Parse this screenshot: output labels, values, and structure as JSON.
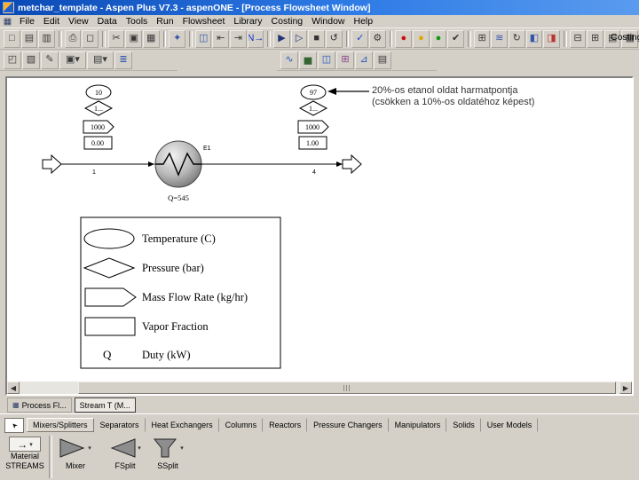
{
  "window": {
    "title": "metchar_template - Aspen Plus V7.3 - aspenONE - [Process Flowsheet Window]"
  },
  "menu": {
    "items": [
      "File",
      "Edit",
      "View",
      "Data",
      "Tools",
      "Run",
      "Flowsheet",
      "Library",
      "Costing",
      "Window",
      "Help"
    ]
  },
  "costing_button": {
    "label": "Costing"
  },
  "toolbar_main": {
    "buttons": [
      {
        "name": "new-icon",
        "glyph": "□"
      },
      {
        "name": "open-icon",
        "glyph": "▤"
      },
      {
        "name": "save-icon",
        "glyph": "▥"
      },
      {
        "sep": true
      },
      {
        "name": "print-icon",
        "glyph": "⎙"
      },
      {
        "name": "print-preview-icon",
        "glyph": "◻"
      },
      {
        "sep": true
      },
      {
        "name": "cut-icon",
        "glyph": "✂"
      },
      {
        "name": "copy-icon",
        "glyph": "▣"
      },
      {
        "name": "paste-icon",
        "glyph": "▦"
      },
      {
        "sep": true
      },
      {
        "name": "analysis-tools-icon",
        "glyph": "✦",
        "color": "#3355aa"
      },
      {
        "sep": true
      },
      {
        "name": "data-browser-icon",
        "glyph": "◫",
        "color": "#3355aa"
      },
      {
        "name": "prev-input-icon",
        "glyph": "⇤"
      },
      {
        "name": "next-input-icon",
        "glyph": "⇥"
      },
      {
        "name": "next-step-icon",
        "glyph": "N→",
        "color": "#1133bb"
      },
      {
        "sep": true
      },
      {
        "name": "run-icon",
        "glyph": "▶",
        "color": "#223377"
      },
      {
        "name": "step-run-icon",
        "glyph": "▷",
        "color": "#223377"
      },
      {
        "name": "stop-icon",
        "glyph": "■",
        "color": "#333333"
      },
      {
        "name": "reinitialize-icon",
        "glyph": "↺",
        "color": "#333333"
      },
      {
        "sep": true
      },
      {
        "name": "control-panel-icon",
        "glyph": "✓",
        "color": "#1144cc"
      },
      {
        "name": "settings-icon",
        "glyph": "⚙"
      },
      {
        "sep": true
      },
      {
        "name": "status-error-icon",
        "glyph": "●",
        "color": "#cc1111"
      },
      {
        "name": "status-warning-icon",
        "glyph": "●",
        "color": "#ddaa00"
      },
      {
        "name": "status-ok-icon",
        "glyph": "●",
        "color": "#119911"
      },
      {
        "name": "check-results-icon",
        "glyph": "✔",
        "color": "#333333"
      },
      {
        "sep": true
      },
      {
        "name": "insert-block-icon",
        "glyph": "⊞"
      },
      {
        "name": "exchanger-curves-icon",
        "glyph": "≋",
        "color": "#3355aa"
      },
      {
        "name": "rotate-icon",
        "glyph": "↻"
      },
      {
        "name": "flip-icon",
        "glyph": "◧",
        "color": "#3355aa"
      },
      {
        "name": "economics-icon",
        "glyph": "◨",
        "color": "#bb3333"
      },
      {
        "sep": true
      },
      {
        "name": "stream-table-icon",
        "glyph": "⊟"
      },
      {
        "name": "property-table-icon",
        "glyph": "⊞"
      },
      {
        "name": "report-icon",
        "glyph": "▤"
      },
      {
        "name": "matrix-icon",
        "glyph": "▦"
      }
    ]
  },
  "toolbar_secondary_left": {
    "buttons": [
      {
        "name": "zoom-full-icon",
        "glyph": "◰"
      },
      {
        "name": "annotation-icon",
        "glyph": "▧"
      },
      {
        "name": "draw-text-icon",
        "glyph": "✎"
      },
      {
        "name": "view-scale-dropdown",
        "glyph": "▣▾",
        "wide": true
      },
      {
        "name": "section-dropdown",
        "glyph": "▤▾",
        "wide": true
      },
      {
        "name": "grid-icon",
        "glyph": "≣",
        "color": "#3355aa"
      }
    ]
  },
  "toolbar_secondary_right": {
    "buttons": [
      {
        "name": "plot-icon",
        "glyph": "∿",
        "color": "#2255bb"
      },
      {
        "name": "chart-icon",
        "glyph": "▅",
        "color": "#336633"
      },
      {
        "name": "stream-summary-icon",
        "glyph": "◫",
        "color": "#2255bb"
      },
      {
        "name": "table-tool-icon",
        "glyph": "⊞",
        "color": "#884488"
      },
      {
        "name": "sensitivity-icon",
        "glyph": "⊿",
        "color": "#2255bb"
      },
      {
        "name": "data-fit-icon",
        "glyph": "▤"
      }
    ]
  },
  "flowsheet": {
    "annotation": {
      "line1": "20%-os etanol oldat harmatpontja",
      "line2": "(csökken a 10%-os oldatéhoz képest)"
    },
    "feed_stream": {
      "id": "1",
      "temperature": "10",
      "pressure": "1...",
      "mass_flow": "1000",
      "vapor_fraction": "0.00"
    },
    "product_stream": {
      "id": "4",
      "temperature": "97",
      "pressure": "1...",
      "mass_flow": "1000",
      "vapor_fraction": "1.00"
    },
    "block": {
      "tag": "E1",
      "duty_label": "Q=545"
    },
    "legend": {
      "temperature": "Temperature (C)",
      "pressure": "Pressure (bar)",
      "mass_flow": "Mass Flow Rate (kg/hr)",
      "vapor_fraction": "Vapor Fraction",
      "duty_symbol": "Q",
      "duty": "Duty (kW)"
    }
  },
  "window_tabs": [
    {
      "label": "Process Fl..."
    },
    {
      "label": "Stream T (M..."
    }
  ],
  "library": {
    "tabs": [
      "Mixers/Splitters",
      "Separators",
      "Heat Exchangers",
      "Columns",
      "Reactors",
      "Pressure Changers",
      "Manipulators",
      "Solids",
      "User Models"
    ],
    "selected_tab": "Mixers/Splitters",
    "stream_selector": {
      "line1": "Material",
      "line2": "STREAMS"
    },
    "models": [
      {
        "label": "Mixer"
      },
      {
        "label": "FSplit"
      },
      {
        "label": "SSplit"
      }
    ]
  },
  "icons": {
    "dropdown_arrow": "▾",
    "scroll_left": "◀",
    "scroll_right": "▶",
    "pointer_arrow": "➤",
    "window_glyph": "▦",
    "flowsheet_tab_glyph": "▦",
    "material_stream_arrow": "→"
  }
}
